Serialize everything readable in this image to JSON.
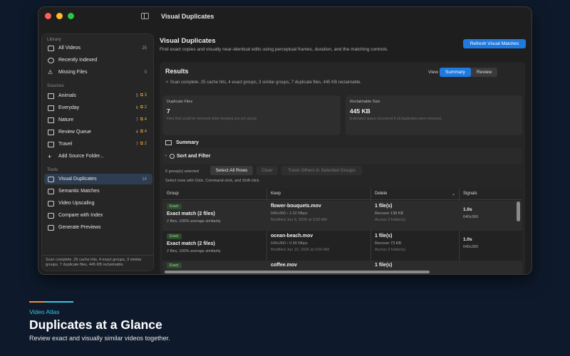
{
  "window": {
    "title": "Visual Duplicates"
  },
  "sidebar": {
    "library_label": "Library",
    "library": [
      {
        "label": "All Videos",
        "count": "25"
      },
      {
        "label": "Recently Indexed",
        "count": ""
      },
      {
        "label": "Missing Files",
        "count": "0"
      }
    ],
    "sources_label": "Sources",
    "sources": [
      {
        "label": "Animals",
        "count": "5",
        "dups": "3"
      },
      {
        "label": "Everyday",
        "count": "6",
        "dups": "2"
      },
      {
        "label": "Nature",
        "count": "7",
        "dups": "4"
      },
      {
        "label": "Review Queue",
        "count": "4",
        "dups": "4"
      },
      {
        "label": "Travel",
        "count": "7",
        "dups": "2"
      }
    ],
    "add_source": "Add Source Folder...",
    "tools_label": "Tools",
    "tools": [
      {
        "label": "Visual Duplicates",
        "count": "14"
      },
      {
        "label": "Semantic Matches",
        "count": ""
      },
      {
        "label": "Video Upscaling",
        "count": ""
      },
      {
        "label": "Compare with Index",
        "count": ""
      },
      {
        "label": "Generate Previews",
        "count": ""
      }
    ],
    "status": "Scan complete. 25 cache hits, 4 exact groups, 3 similar groups, 7 duplicate files, 445 KB reclaimable."
  },
  "main": {
    "title": "Visual Duplicates",
    "subtitle": "Find exact copies and visually near-identical edits using perceptual frames, duration, and the matching controls.",
    "refresh_label": "Refresh Visual Matches",
    "results_title": "Results",
    "results_status": "Scan complete. 25 cache hits, 4 exact groups, 3 similar groups, 7 duplicate files, 445 KB reclaimable.",
    "view_label": "View",
    "view_options": [
      "Summary",
      "Review"
    ],
    "view_selected": "Summary",
    "cards": [
      {
        "label": "Duplicate Files",
        "value": "7",
        "note": "Files that could be removed while keeping one per group."
      },
      {
        "label": "Reclaimable Size",
        "value": "445 KB",
        "note": "Estimated space recovered if all duplicates were removed."
      }
    ],
    "summary_label": "Summary",
    "sort_filter_label": "Sort and Filter",
    "selected_count": "0 group(s) selected",
    "select_all": "Select All Rows",
    "clear": "Clear",
    "trash_others": "Trash Others in Selected Groups",
    "selection_help": "Select rows with Click, Command-click, and Shift-click.",
    "columns": [
      "Group",
      "Keep",
      "Delete",
      "Signals"
    ],
    "rows": [
      {
        "badge": "Exact",
        "title": "Exact match (2 files)",
        "similarity": "2 files, 100% average similarity",
        "keep_file": "flower-bouquets.mov",
        "keep_meta": "640x360 • 1.02 Mbps",
        "keep_modified": "Modified Jun 9, 2026 at 3:00 AM",
        "delete_files": "1 file(s)",
        "recover": "Recover 138 KB",
        "across": "Across 2 folder(s)",
        "duration": "1.0s",
        "resolution": "640x360"
      },
      {
        "badge": "Exact",
        "title": "Exact match (2 files)",
        "similarity": "2 files, 100% average similarity",
        "keep_file": "ocean-beach.mov",
        "keep_meta": "640x360 • 0.58 Mbps",
        "keep_modified": "Modified Jun 10, 2026 at 3:00 AM",
        "delete_files": "1 file(s)",
        "recover": "Recover 73 KB",
        "across": "Across 2 folder(s)",
        "duration": "1.0s",
        "resolution": "640x360"
      },
      {
        "badge": "Exact",
        "title": "",
        "similarity": "",
        "keep_file": "coffee.mov",
        "keep_meta": "",
        "keep_modified": "",
        "delete_files": "1 file(s)",
        "recover": "",
        "across": "",
        "duration": "",
        "resolution": ""
      }
    ]
  },
  "footer": {
    "brand": "Video Atlas",
    "headline": "Duplicates at a Glance",
    "tagline": "Review exact and visually similar videos together."
  },
  "colors": {
    "accent": "#1f7ae0",
    "brand_orange": "#f0913a",
    "brand_cyan": "#39c6e6"
  }
}
